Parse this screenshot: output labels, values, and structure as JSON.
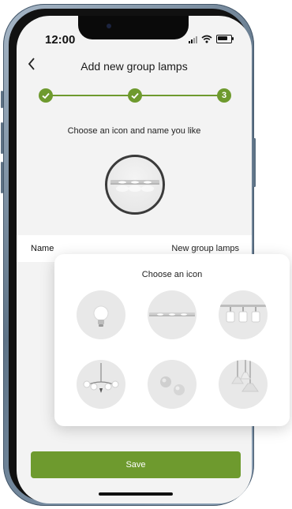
{
  "status_bar": {
    "time": "12:00"
  },
  "header": {
    "back_icon": "chevron-left-icon",
    "title": "Add new group lamps"
  },
  "stepper": {
    "steps": [
      {
        "state": "done",
        "icon": "check-icon"
      },
      {
        "state": "done",
        "icon": "check-icon"
      },
      {
        "state": "current",
        "label": "3"
      }
    ],
    "color": "#6e9a2e"
  },
  "content": {
    "subtitle": "Choose an icon and name you like",
    "selected_icon": "track-light-icon"
  },
  "name_field": {
    "label": "Name",
    "value": "New group lamps"
  },
  "footer": {
    "save_label": "Save"
  },
  "icon_picker": {
    "title": "Choose an icon",
    "options": [
      {
        "icon": "bulb-icon"
      },
      {
        "icon": "track-light-icon"
      },
      {
        "icon": "spotlights-icon"
      },
      {
        "icon": "chandelier-icon"
      },
      {
        "icon": "round-lamps-icon"
      },
      {
        "icon": "pendant-lamps-icon"
      }
    ]
  },
  "colors": {
    "accent": "#6e9a2e",
    "screen_bg": "#f3f3f3"
  }
}
